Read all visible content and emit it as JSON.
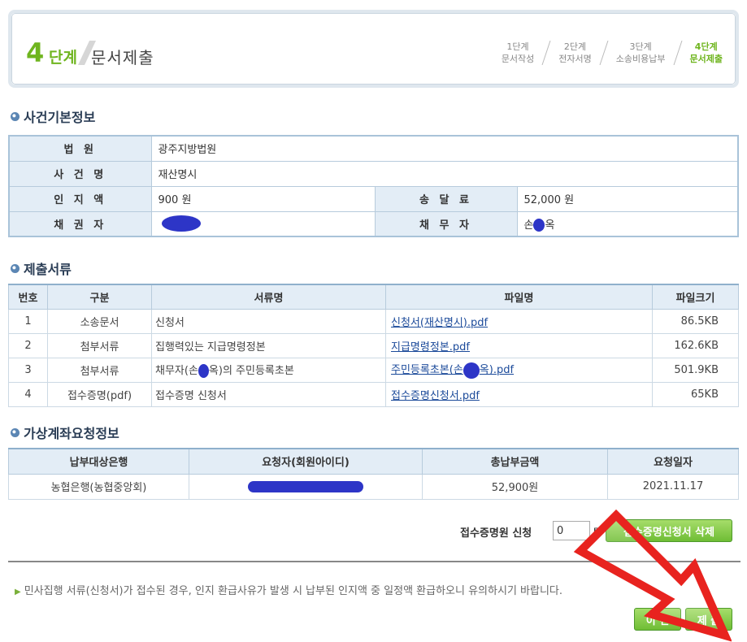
{
  "step": {
    "number": "4",
    "number_label": "단계",
    "title": "문서제출",
    "items": [
      {
        "step": "1단계",
        "label": "문서작성"
      },
      {
        "step": "2단계",
        "label": "전자서명"
      },
      {
        "step": "3단계",
        "label": "소송비용납부"
      },
      {
        "step": "4단계",
        "label": "문서제출"
      }
    ]
  },
  "case_info": {
    "title": "사건기본정보",
    "court_label": "법 원",
    "court": "광주지방법원",
    "case_name_label": "사 건 명",
    "case_name": "재산명시",
    "stamp_label": "인 지 액",
    "stamp": "900 원",
    "service_label": "송 달 료",
    "service": "52,000 원",
    "creditor_label": "채 권 자",
    "debtor_label": "채 무 자",
    "debtor_prefix": "손",
    "debtor_suffix": "옥"
  },
  "documents": {
    "title": "제출서류",
    "headers": [
      "번호",
      "구분",
      "서류명",
      "파일명",
      "파일크기"
    ],
    "rows": [
      {
        "no": "1",
        "type": "소송문서",
        "name": "신청서",
        "file": "신청서(재산명시).pdf",
        "size": "86.5KB"
      },
      {
        "no": "2",
        "type": "첨부서류",
        "name": "집행력있는 지급명령정본",
        "file": "지급명령정본.pdf",
        "size": "162.6KB"
      },
      {
        "no": "3",
        "type": "첨부서류",
        "name_prefix": "채무자(손",
        "name_suffix": "옥)의 주민등록초본",
        "file_prefix": "주민등록초본(손",
        "file_suffix": "옥).pdf",
        "size": "501.9KB"
      },
      {
        "no": "4",
        "type": "접수증명(pdf)",
        "name": "접수증명 신청서",
        "file": "접수증명신청서.pdf",
        "size": "65KB"
      }
    ]
  },
  "virtual_account": {
    "title": "가상계좌요청정보",
    "headers": [
      "납부대상은행",
      "요청자(회원아이디)",
      "총납부금액",
      "요청일자"
    ],
    "bank": "농협은행(농협중앙회)",
    "amount": "52,900원",
    "date": "2021.11.17"
  },
  "receipt": {
    "label": "접수증명원 신청",
    "count": "0",
    "unit": "통",
    "delete_button": "접수증명신청서 삭제"
  },
  "notice": "민사집행 서류(신청서)가 접수된 경우, 인지 환급사유가 발생 시 납부된 인지액 중 일정액 환급하오니 유의하시기 바랍니다.",
  "buttons": {
    "prev": "이 전",
    "submit": "제 출"
  },
  "colors": {
    "accent_green": "#6fb51f",
    "header_blue": "#e3edf6",
    "annotation_red": "#e8231f",
    "redaction": "#2d35c7"
  }
}
